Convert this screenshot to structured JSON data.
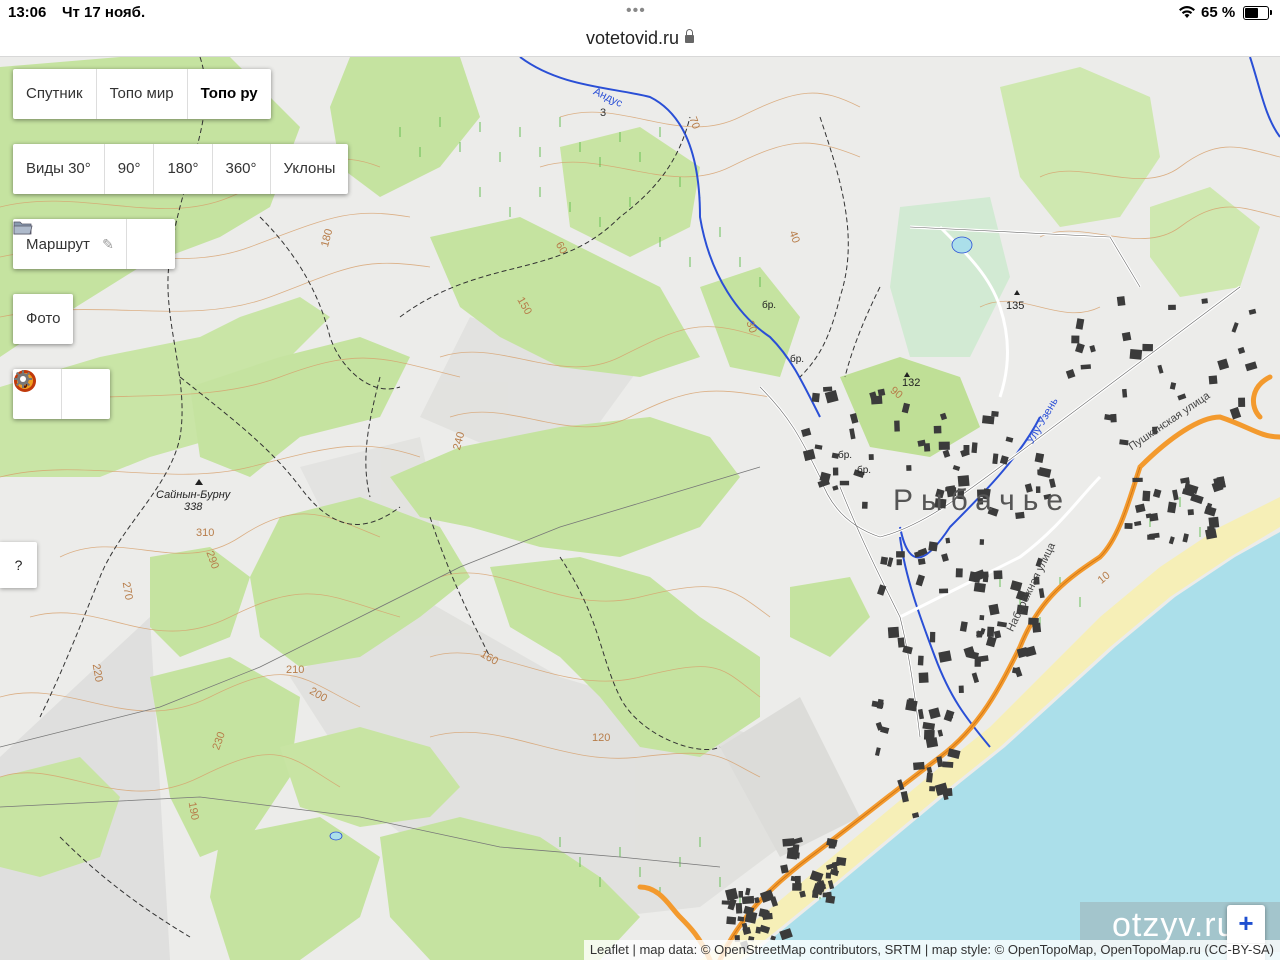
{
  "status_bar": {
    "time": "13:06",
    "date": "Чт 17 нояб.",
    "battery": "65 %",
    "battery_level": 0.65
  },
  "browser": {
    "url": "votetovid.ru"
  },
  "layer_controls": {
    "buttons": [
      {
        "label": "Спутник",
        "active": false
      },
      {
        "label": "Топо мир",
        "active": false
      },
      {
        "label": "Топо ру",
        "active": true
      }
    ]
  },
  "view_controls": {
    "buttons": [
      "Виды 30°",
      "90°",
      "180°",
      "360°",
      "Уклоны"
    ]
  },
  "route_control": {
    "label": "Маршрут",
    "icons": [
      "pencil-icon",
      "folder-icon"
    ]
  },
  "photo_control": {
    "label": "Фото"
  },
  "tool_icons": [
    "compass-icon",
    "gear-icon"
  ],
  "help_button": "?",
  "zoom": {
    "in": "+",
    "out": "−"
  },
  "watermark": "otzyv.ru",
  "attribution": "Leaflet | map data: © OpenStreetMap contributors, SRTM | map style: © OpenTopoMap, OpenTopoMap.ru (CC-BY-SA)",
  "map_labels": {
    "peak_name": "Сайнын-Бурну",
    "peak_elev": "338",
    "town": "Рыбачье",
    "spot_132": "132",
    "spot_135": "135",
    "street_1": "Набережная улица",
    "street_2": "Пушкинская улица",
    "river_1": "Андус",
    "river_2": "Улу-Узень",
    "contours": [
      "180",
      "150",
      "120",
      "190",
      "220",
      "240",
      "230",
      "210",
      "200",
      "160",
      "270",
      "290",
      "310",
      "90",
      "60",
      "30",
      "70",
      "40",
      "10",
      "3"
    ],
    "br": [
      "бр.",
      "бр.",
      "бр.",
      "бр."
    ]
  },
  "colors": {
    "forest": "#c5e3a0",
    "forest_dark": "#b6d98a",
    "terrain": "#ececea",
    "sea": "#abdfea",
    "road": "#f39a2e",
    "river": "#2a4fd6",
    "building": "#3b3b3b",
    "beach": "#f6efb7"
  }
}
